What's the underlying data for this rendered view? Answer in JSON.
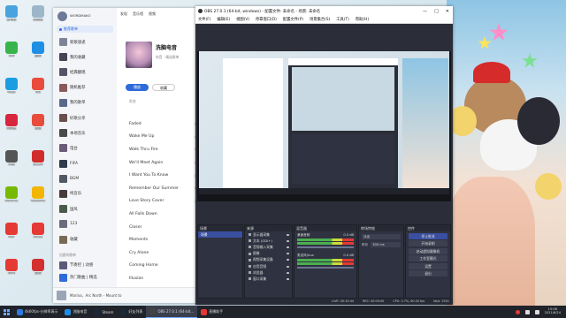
{
  "desktop_icons": [
    {
      "label": "此电脑",
      "color": "#4aa3df"
    },
    {
      "label": "回收站",
      "color": "#9bb7c9"
    },
    {
      "label": "360",
      "color": "#38b44a"
    },
    {
      "label": "酷狗",
      "color": "#1f8fe5"
    },
    {
      "label": "Edge",
      "color": "#1b9de2"
    },
    {
      "label": "QQ",
      "color": "#e94b3c"
    },
    {
      "label": "网易云",
      "color": "#d7263d"
    },
    {
      "label": "微信",
      "color": "#e84c3d"
    },
    {
      "label": "OBS",
      "color": "#555"
    },
    {
      "label": "Steam",
      "color": "#d12c2c"
    },
    {
      "label": "GeForce",
      "color": "#76b900"
    },
    {
      "label": "WeGame",
      "color": "#f2b600"
    },
    {
      "label": "PDF",
      "color": "#e53935"
    },
    {
      "label": "Office",
      "color": "#e53935"
    },
    {
      "label": "WPS",
      "color": "#e53935"
    },
    {
      "label": "剪映",
      "color": "#d32f2f"
    }
  ],
  "music": {
    "header_user": "WORDMAKO",
    "nav": [
      "推荐歌单",
      "发现",
      "音乐馆",
      "视频"
    ],
    "sidebar_items": [
      {
        "label": "新歌速递",
        "color": "#7b8597"
      },
      {
        "label": "我的收藏",
        "color": "#445"
      },
      {
        "label": "经典翻唱",
        "color": "#556"
      },
      {
        "label": "随机推荐",
        "color": "#8a5a5a"
      },
      {
        "label": "我的歌单",
        "color": "#5a6a8a"
      },
      {
        "label": "好歌分享",
        "color": "#6b4f4f"
      },
      {
        "label": "本地音乐",
        "color": "#4a4a4a"
      },
      {
        "label": "电台",
        "color": "#6a5b7b"
      },
      {
        "label": "FIFA",
        "color": "#2f3a4c"
      },
      {
        "label": "BGM",
        "color": "#505a66"
      },
      {
        "label": "纯音乐",
        "color": "#463c3c"
      },
      {
        "label": "国风",
        "color": "#4a5a4a"
      },
      {
        "label": "123",
        "color": "#6b6b7b"
      },
      {
        "label": "收藏",
        "color": "#7a6a55"
      }
    ],
    "sidebar_section_label": "创建的歌单",
    "sidebar_sub_items": [
      {
        "label": "节奏控 | 动感",
        "color": "#5a5a7a"
      },
      {
        "label": "热门歌曲 | 精选",
        "color": "#2f6bd9"
      }
    ],
    "playlist_title": "洗脑电音",
    "playlist_meta": "电音 · 精选歌单",
    "play_all": "播放",
    "collect": "收藏",
    "list_header": "歌曲",
    "songs": [
      "Faded",
      "Wake Me Up",
      "Walk Thru Fire",
      "We'll Meet Again",
      "I Want You To Know",
      "Remember Our Summer",
      "Love Story Cover",
      "All Falls Down",
      "Closer",
      "Moments",
      "Cry Alone",
      "Coming Home",
      "Illusion"
    ],
    "now_playing": "Marina、Arc North - Mount to"
  },
  "obs": {
    "title": "OBS 27.0.1 (64-bit, windows) - 配置文件: 未命名 - 场景: 未命名",
    "menu": [
      "文件(F)",
      "编辑(E)",
      "视图(V)",
      "停靠窗口(D)",
      "配置文件(P)",
      "场景集合(S)",
      "工具(T)",
      "帮助(H)"
    ],
    "docks": {
      "scenes_title": "场景",
      "scene_name": "场景",
      "sources_title": "来源",
      "sources": [
        "显示器采集",
        "文本 (GDI+)",
        "音频输入采集",
        "图像",
        "视频采集设备",
        "应用音频",
        "浏览器",
        "窗口采集"
      ],
      "mixer_title": "混音器",
      "mixer_tracks": [
        {
          "name": "桌面音频",
          "db": "0.0 dB"
        },
        {
          "name": "麦克风/Aux",
          "db": "0.0 dB"
        }
      ],
      "transitions_title": "转场特效",
      "transition_type": "淡出",
      "duration_label": "时长",
      "duration_value": "300 ms",
      "controls_title": "控件",
      "controls": [
        "停止推流",
        "开始录制",
        "启动虚拟摄像机",
        "工作室模式",
        "设置",
        "退出"
      ]
    },
    "status": {
      "live": "LIVE: 00:10:44",
      "rec": "REC: 00:00:00",
      "cpu": "CPU: 0.7%, 60.00 fps",
      "kbps": "kb/s: 2501"
    }
  },
  "taskbar": {
    "items": [
      {
        "label": "4k60fps-分辨率演示",
        "color": "#2d7be0",
        "active": false
      },
      {
        "label": "洗脑电音",
        "color": "#1f8fe5",
        "active": false
      },
      {
        "label": "Steam",
        "color": "#1b2838",
        "active": false
      },
      {
        "label": "好友列表",
        "color": "#1b2838",
        "active": false
      },
      {
        "label": "OBS 27.0.1 (64-bit...",
        "color": "#444",
        "active": true
      },
      {
        "label": "直播助手",
        "color": "#e53935",
        "active": false
      }
    ],
    "time": "15:06",
    "date": "2021/6/24"
  }
}
